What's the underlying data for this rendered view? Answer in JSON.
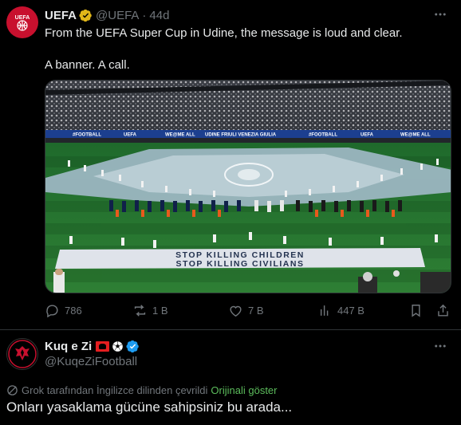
{
  "post1": {
    "display_name": "UEFA",
    "handle": "@UEFA",
    "separator": "·",
    "time": "44d",
    "text_line1": "From the UEFA Super Cup in Udine, the message is loud and clear.",
    "text_line2": "A banner. A call.",
    "banner_line1": "STOP KILLING CHILDREN",
    "banner_line2": "STOP KILLING CIVILIANS",
    "board_texts": [
      "#FOOTBALL",
      "UEFA",
      "WE@ME ALL",
      "UDINE FRIULI VENEZIA GIULIA",
      "#FOOTBALL",
      "UEFA",
      "WE@ME ALL"
    ],
    "actions": {
      "replies": "786",
      "reposts": "1 B",
      "likes": "7 B",
      "views": "447 B"
    }
  },
  "post2": {
    "display_name": "Kuq e Zi",
    "handle": "@KuqeZiFootball",
    "translated_label": "Grok tarafından İngilizce dilinden çevrildi",
    "show_original": "Orijinali göster",
    "text": "Onları yasaklama gücüne sahipsiniz bu arada..."
  },
  "colors": {
    "background": "#000000",
    "text": "#e7e9ea",
    "muted": "#71767b",
    "verified_gold": "#e2b719",
    "verified_blue": "#1d9bf0",
    "link_green": "#5cbc5c"
  },
  "icons": [
    "uefa-logo",
    "gold-verified-badge",
    "more-icon",
    "reply-icon",
    "repost-icon",
    "like-icon",
    "views-icon",
    "bookmark-icon",
    "share-icon",
    "kuqezi-logo",
    "albania-flag",
    "football-emoji",
    "blue-verified-badge",
    "grok-translate-icon"
  ]
}
